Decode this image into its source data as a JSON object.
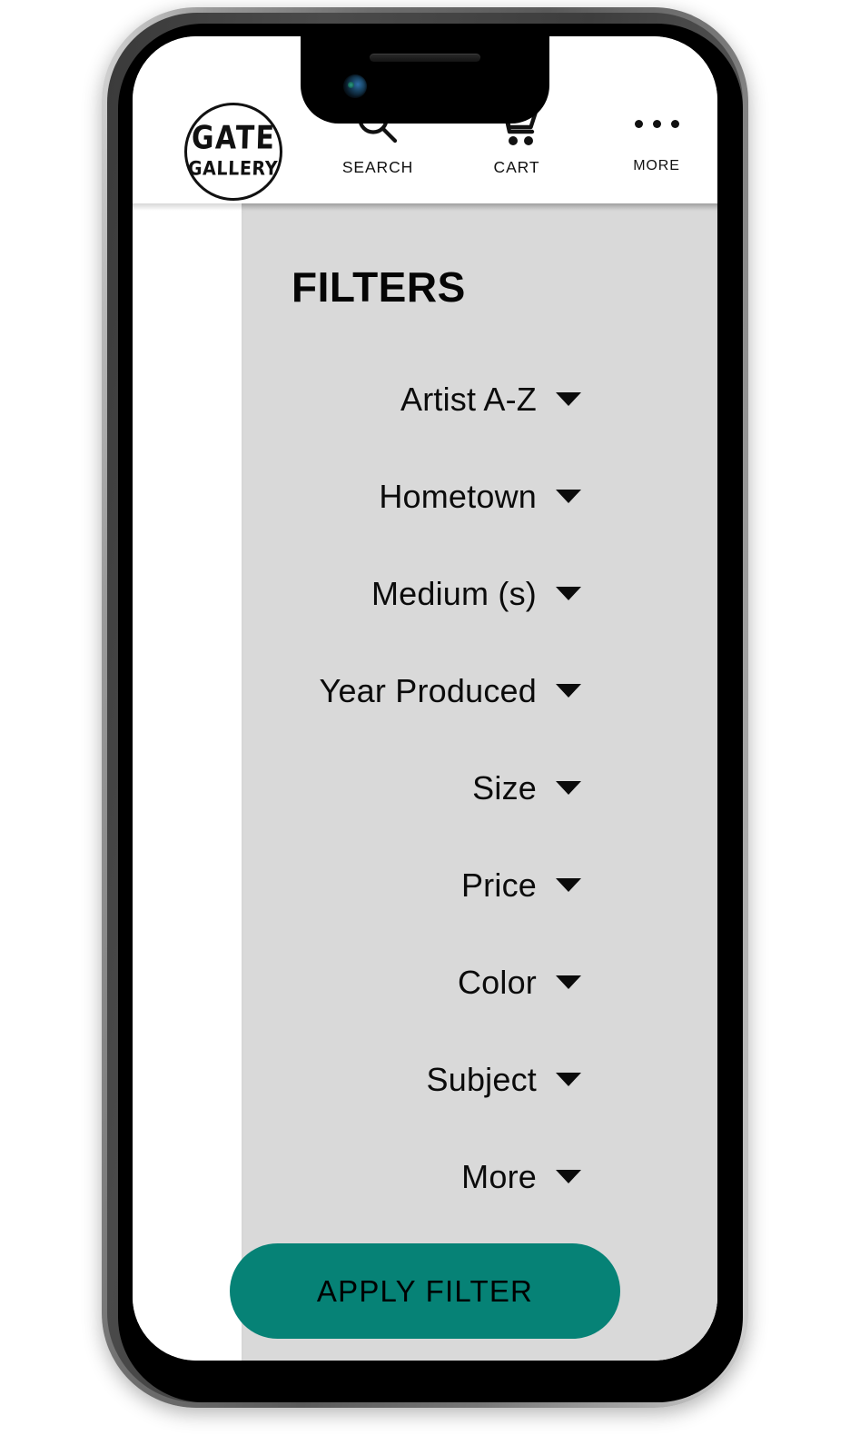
{
  "brand": {
    "logo_line1": "GATE",
    "logo_line2": "GALLERY"
  },
  "header": {
    "nav": [
      {
        "label": "SEARCH",
        "icon": "search-icon"
      },
      {
        "label": "CART",
        "icon": "cart-icon"
      },
      {
        "label": "MORE",
        "icon": "more-dots-icon"
      }
    ]
  },
  "panel": {
    "title": "FILTERS",
    "items": [
      {
        "label": "Artist A-Z",
        "icon": "chevron-down-icon"
      },
      {
        "label": "Hometown",
        "icon": "chevron-down-icon"
      },
      {
        "label": "Medium (s)",
        "icon": "chevron-down-icon"
      },
      {
        "label": "Year Produced",
        "icon": "chevron-down-icon"
      },
      {
        "label": "Size",
        "icon": "chevron-down-icon"
      },
      {
        "label": "Price",
        "icon": "chevron-down-icon"
      },
      {
        "label": "Color",
        "icon": "chevron-down-icon"
      },
      {
        "label": "Subject",
        "icon": "chevron-down-icon"
      },
      {
        "label": "More",
        "icon": "chevron-down-icon"
      }
    ],
    "apply_label": "APPLY FILTER"
  },
  "colors": {
    "accent": "#068276",
    "panel_bg": "#d9d9d9",
    "text": "#0b0b0b",
    "frame": "#000000"
  }
}
